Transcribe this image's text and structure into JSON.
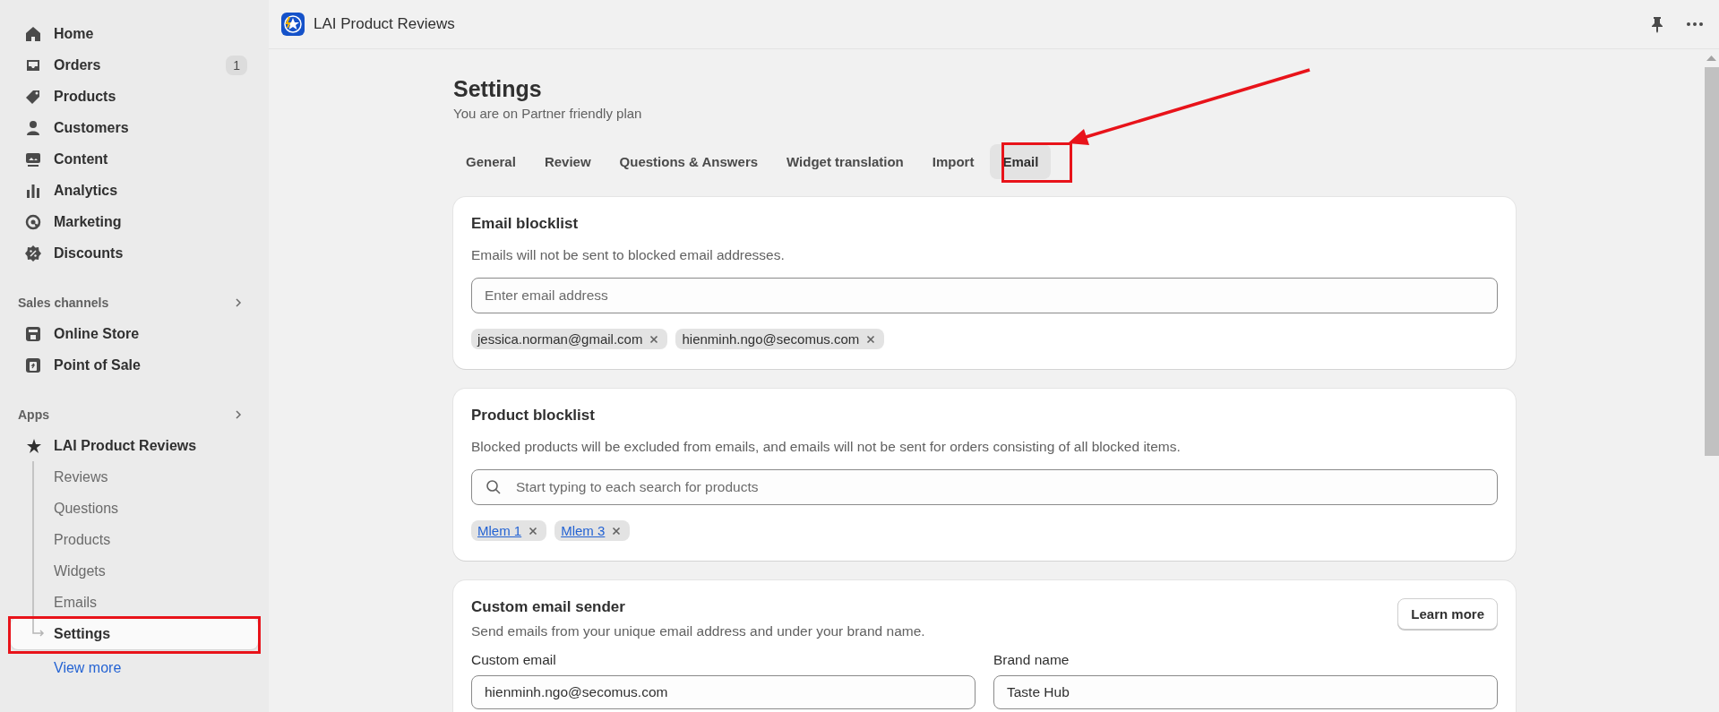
{
  "sidebar": {
    "nav_items": [
      {
        "label": "Home",
        "selected": false
      },
      {
        "label": "Orders",
        "badge": "1",
        "selected": false
      },
      {
        "label": "Products",
        "selected": false
      },
      {
        "label": "Customers",
        "selected": false
      },
      {
        "label": "Content",
        "selected": false
      },
      {
        "label": "Analytics",
        "selected": false
      },
      {
        "label": "Marketing",
        "selected": false
      },
      {
        "label": "Discounts",
        "selected": false
      }
    ],
    "sales_channels": {
      "title": "Sales channels",
      "items": [
        {
          "label": "Online Store",
          "selected": false
        },
        {
          "label": "Point of Sale",
          "selected": false
        }
      ]
    },
    "apps": {
      "title": "Apps",
      "app": {
        "label": "LAI Product Reviews",
        "children": [
          {
            "label": "Reviews",
            "selected": false
          },
          {
            "label": "Questions",
            "selected": false
          },
          {
            "label": "Products",
            "selected": false
          },
          {
            "label": "Widgets",
            "selected": false
          },
          {
            "label": "Emails",
            "selected": false
          },
          {
            "label": "Settings",
            "selected": true
          }
        ]
      }
    },
    "view_more": "View more"
  },
  "header": {
    "app_title": "LAI Product Reviews"
  },
  "page": {
    "title": "Settings",
    "subtitle": "You are on Partner friendly plan"
  },
  "tabs": [
    {
      "label": "General",
      "selected": false
    },
    {
      "label": "Review",
      "selected": false
    },
    {
      "label": "Questions & Answers",
      "selected": false
    },
    {
      "label": "Widget translation",
      "selected": false
    },
    {
      "label": "Import",
      "selected": false
    },
    {
      "label": "Email",
      "selected": true
    }
  ],
  "email_blocklist": {
    "title": "Email blocklist",
    "description": "Emails will not be sent to blocked email addresses.",
    "placeholder": "Enter email address",
    "tags": [
      "jessica.norman@gmail.com",
      "hienminh.ngo@secomus.com"
    ]
  },
  "product_blocklist": {
    "title": "Product blocklist",
    "description": "Blocked products will be excluded from emails, and emails will not be sent for orders consisting of all blocked items.",
    "placeholder": "Start typing to each search for products",
    "tags": [
      "Mlem 1",
      "Mlem 3"
    ]
  },
  "custom_email_sender": {
    "title": "Custom email sender",
    "description": "Send emails from your unique email address and under your brand name.",
    "button": "Learn more",
    "fields": [
      {
        "label": "Custom email",
        "value": "hienminh.ngo@secomus.com"
      },
      {
        "label": "Brand name",
        "value": "Taste Hub"
      }
    ]
  }
}
